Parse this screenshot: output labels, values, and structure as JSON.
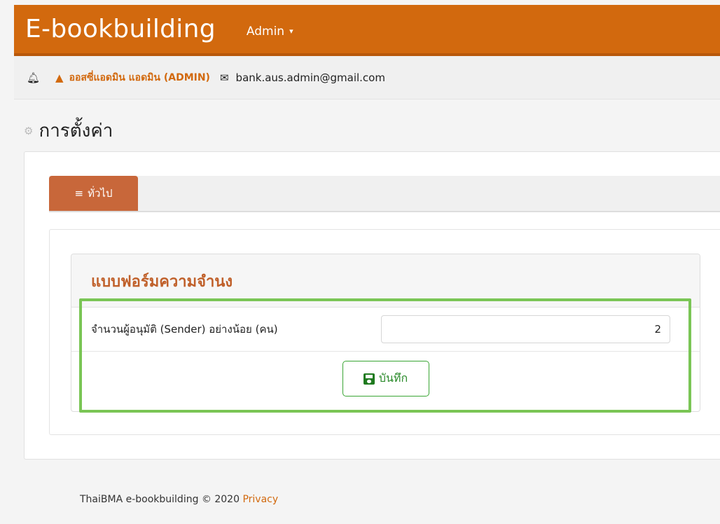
{
  "navbar": {
    "brand": "E-bookbuilding",
    "admin_menu": "Admin"
  },
  "infobar": {
    "user_name": "ออสซี่แอดมิน แอดมิน (ADMIN)",
    "email": "bank.aus.admin@gmail.com"
  },
  "page": {
    "title": "การตั้งค่า"
  },
  "tabs": [
    {
      "label": "ทั่วไป",
      "active": true
    }
  ],
  "form": {
    "title": "แบบฟอร์มความจำนง",
    "field_label": "จำนวนผู้อนุมัติ (Sender) อย่างน้อย (คน)",
    "field_value": "2",
    "save_label": "บันทึก"
  },
  "footer": {
    "text": "ThaiBMA e-bookbuilding © 2020",
    "privacy": "Privacy"
  },
  "colors": {
    "brand_orange": "#d2690e",
    "tab_active": "#c8673a",
    "form_title": "#c0602a",
    "save_green": "#2a8a2a",
    "highlight": "#7ac555"
  }
}
